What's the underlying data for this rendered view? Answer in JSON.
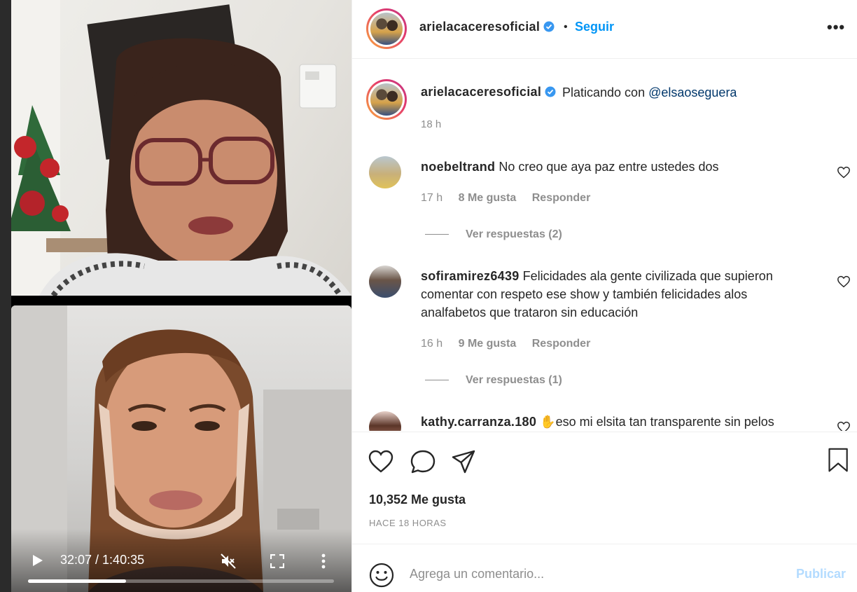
{
  "video": {
    "time": "32:07 / 1:40:35",
    "progress_fraction": 0.32
  },
  "header": {
    "username": "arielacaceresoficial",
    "dot": "•",
    "follow_label": "Seguir",
    "more_label": "•••"
  },
  "caption": {
    "username": "arielacaceresoficial",
    "text_prefix": "Platicando con ",
    "mention": "@elsaoseguera",
    "time": "18 h"
  },
  "comments": [
    {
      "username": "noebeltrand",
      "text": "No creo que aya paz entre ustedes dos",
      "time": "17 h",
      "likes": "8 Me gusta",
      "reply": "Responder",
      "view_replies": "Ver respuestas (2)"
    },
    {
      "username": "sofiramirez6439",
      "text": "Felicidades ala gente civilizada que supieron comentar con respeto ese show y también felicidades alos analfabetos que trataron sin educación",
      "time": "16 h",
      "likes": "9 Me gusta",
      "reply": "Responder",
      "view_replies": "Ver respuestas (1)"
    },
    {
      "username": "kathy.carranza.180",
      "text": "✋eso mi elsita tan transparente sin pelos"
    }
  ],
  "actions": {
    "likes": "10,352 Me gusta",
    "ago": "HACE 18 HORAS"
  },
  "add_comment": {
    "placeholder": "Agrega un comentario...",
    "publish": "Publicar"
  },
  "colors": {
    "accent": "#0095f6",
    "muted": "#8e8e8e",
    "text": "#262626"
  }
}
